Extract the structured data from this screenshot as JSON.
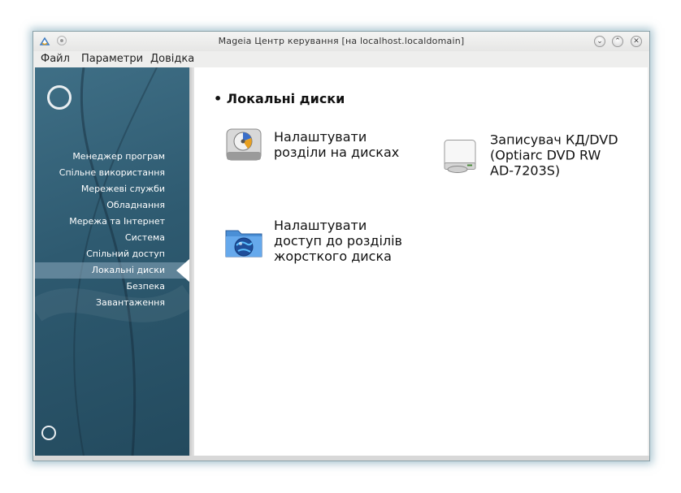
{
  "window": {
    "title": "Mageia Центр керування  [на localhost.localdomain]",
    "buttons": {
      "minimize": "⌄",
      "maximize": "⌃",
      "close": "✕"
    }
  },
  "menubar": {
    "items": [
      {
        "label": "Файл"
      },
      {
        "label": "Параметри"
      },
      {
        "label": "Довідка"
      }
    ]
  },
  "sidebar": {
    "items": [
      {
        "label": "Менеджер програм"
      },
      {
        "label": "Спільне використання"
      },
      {
        "label": "Мережеві служби"
      },
      {
        "label": "Обладнання"
      },
      {
        "label": "Мережа та Інтернет"
      },
      {
        "label": "Система"
      },
      {
        "label": "Спільний доступ"
      },
      {
        "label": "Локальні диски",
        "active": true
      },
      {
        "label": "Безпека"
      },
      {
        "label": "Завантаження"
      }
    ]
  },
  "content": {
    "section_title": "Локальні диски",
    "tools": [
      {
        "label_lines": [
          "Налаштувати",
          "розділи на дисках"
        ],
        "icon": "hard-disk-partition-icon"
      },
      {
        "label_lines": [
          "Записувач КД/DVD",
          "(Optiarc DVD RW",
          "AD-7203S)"
        ],
        "icon": "optical-drive-icon"
      },
      {
        "label_lines": [
          "Налаштувати",
          "доступ до розділів",
          "жорсткого диска"
        ],
        "icon": "network-folder-icon"
      }
    ]
  },
  "colors": {
    "sidebar_bg": "#2e5a70",
    "sidebar_active": "#8caabe",
    "content_bg": "#ffffff"
  }
}
